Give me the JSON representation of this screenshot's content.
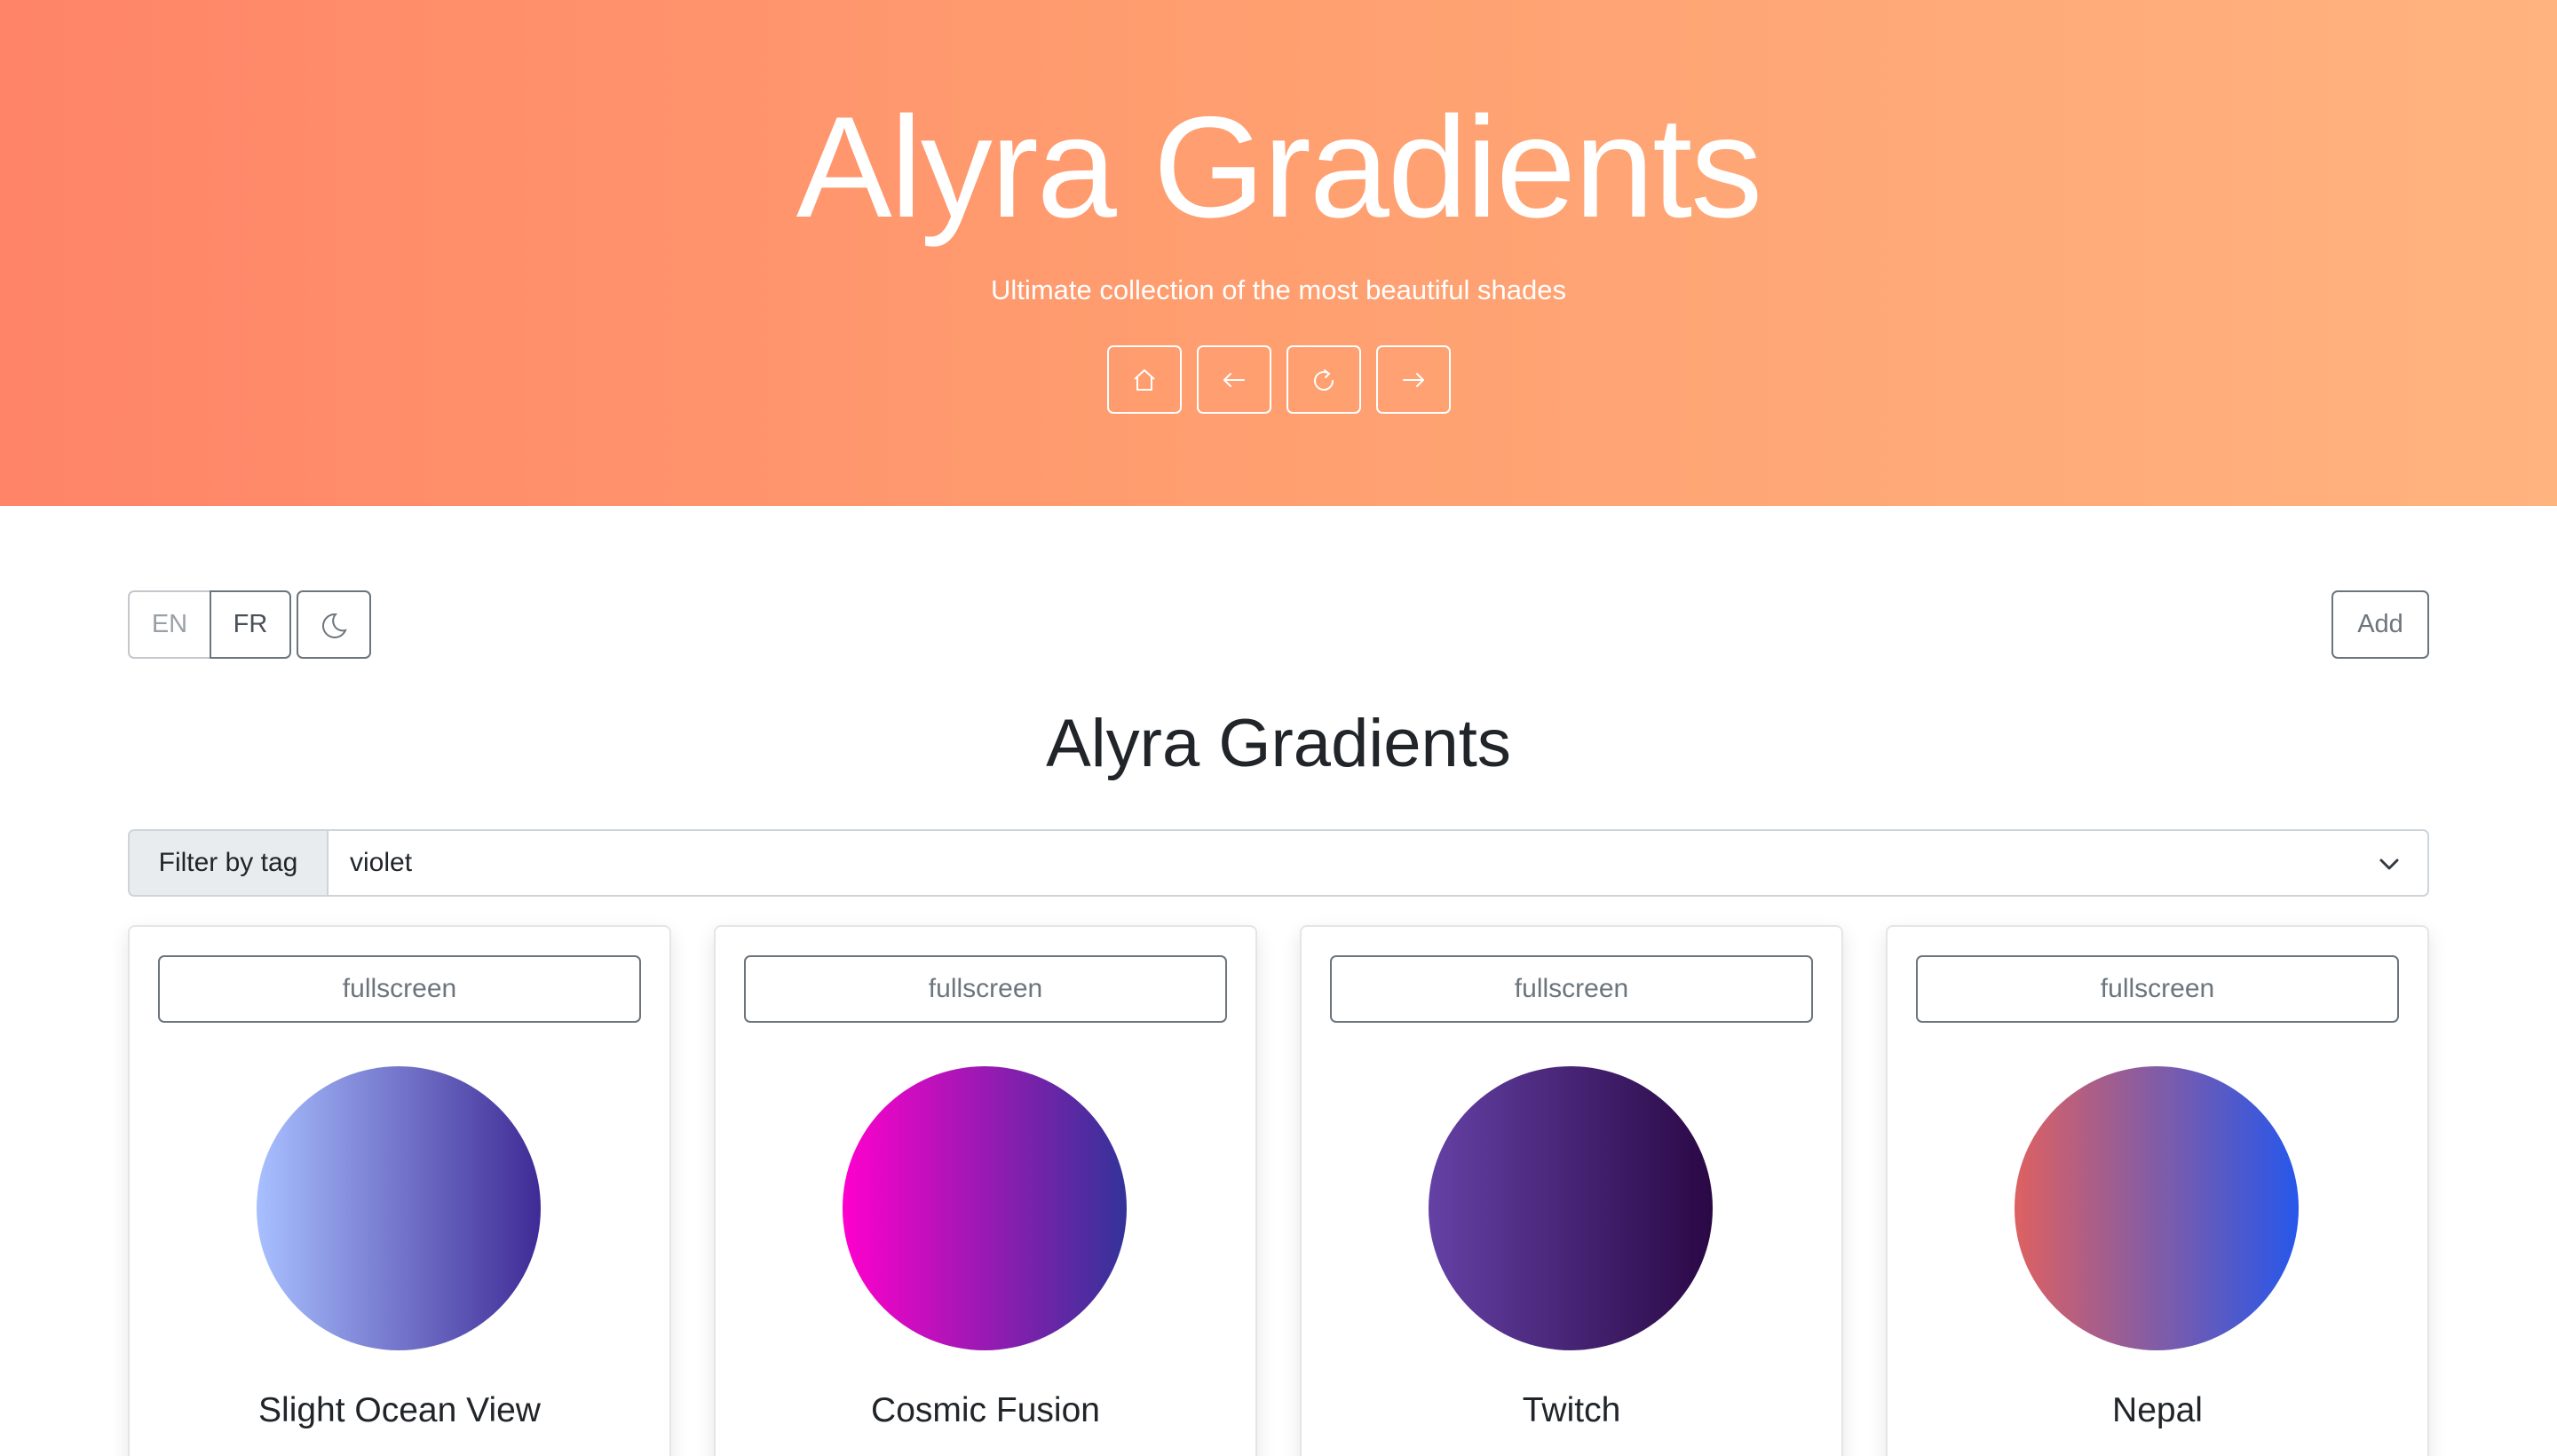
{
  "hero": {
    "title": "Alyra Gradients",
    "subtitle": "Ultimate collection of the most beautiful shades",
    "nav": [
      {
        "icon": "home-icon"
      },
      {
        "icon": "arrow-left-icon"
      },
      {
        "icon": "refresh-icon"
      },
      {
        "icon": "arrow-right-icon"
      }
    ],
    "gradient": [
      "#ff8468",
      "#ffb37f"
    ]
  },
  "toolbar": {
    "lang_en": "EN",
    "lang_fr": "FR",
    "theme_icon": "moon-icon",
    "add_label": "Add"
  },
  "page_title": "Alyra Gradients",
  "filter": {
    "label": "Filter by tag",
    "selected": "violet",
    "icon": "chevron-down-icon"
  },
  "cards": [
    {
      "fullscreen_label": "fullscreen",
      "name": "Slight Ocean View",
      "colors": [
        "#a8c0ff",
        "#3f2b96"
      ]
    },
    {
      "fullscreen_label": "fullscreen",
      "name": "Cosmic Fusion",
      "colors": [
        "#ff00cc",
        "#333399"
      ]
    },
    {
      "fullscreen_label": "fullscreen",
      "name": "Twitch",
      "colors": [
        "#6441a5",
        "#2a0845"
      ]
    },
    {
      "fullscreen_label": "fullscreen",
      "name": "Nepal",
      "colors": [
        "#de6161",
        "#2657eb"
      ]
    }
  ]
}
